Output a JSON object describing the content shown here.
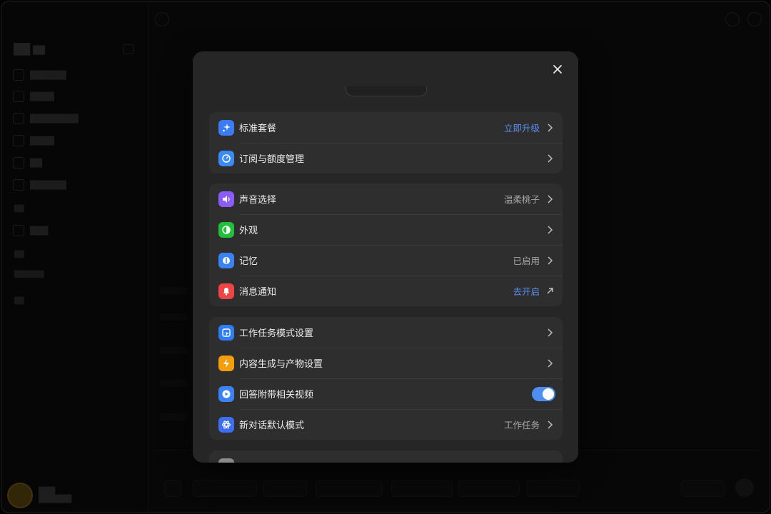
{
  "settings": {
    "groups": [
      {
        "rows": [
          {
            "label": "标准套餐",
            "value": "立即升级",
            "value_style": "link",
            "icon": "sparkle-icon",
            "color": "#3b7cf5",
            "action": "chevron"
          },
          {
            "label": "订阅与额度管理",
            "value": "",
            "icon": "gauge-icon",
            "color": "#3b8af5",
            "action": "chevron"
          }
        ]
      },
      {
        "rows": [
          {
            "label": "声音选择",
            "value": "温柔桃子",
            "value_style": "muted",
            "icon": "speaker-icon",
            "color": "#8b5cf6",
            "action": "chevron"
          },
          {
            "label": "外观",
            "value": "",
            "icon": "contrast-icon",
            "color": "#22c03a",
            "action": "chevron"
          },
          {
            "label": "记忆",
            "value": "已启用",
            "value_style": "muted",
            "icon": "memory-icon",
            "color": "#3b82f6",
            "action": "chevron"
          },
          {
            "label": "消息通知",
            "value": "去开启",
            "value_style": "link",
            "icon": "bell-icon",
            "color": "#ef4444",
            "action": "external"
          }
        ]
      },
      {
        "rows": [
          {
            "label": "工作任务模式设置",
            "value": "",
            "icon": "cursor-icon",
            "color": "#2f7cf6",
            "action": "chevron"
          },
          {
            "label": "内容生成与产物设置",
            "value": "",
            "icon": "bolt-icon",
            "color": "#f59e0b",
            "action": "chevron"
          },
          {
            "label": "回答附带相关视频",
            "value": "",
            "icon": "play-icon",
            "color": "#3b82f6",
            "action": "toggle",
            "toggle_on": true
          },
          {
            "label": "新对话默认模式",
            "value": "工作任务",
            "value_style": "muted",
            "icon": "atom-icon",
            "color": "#3b6ef0",
            "action": "chevron"
          }
        ]
      }
    ]
  }
}
